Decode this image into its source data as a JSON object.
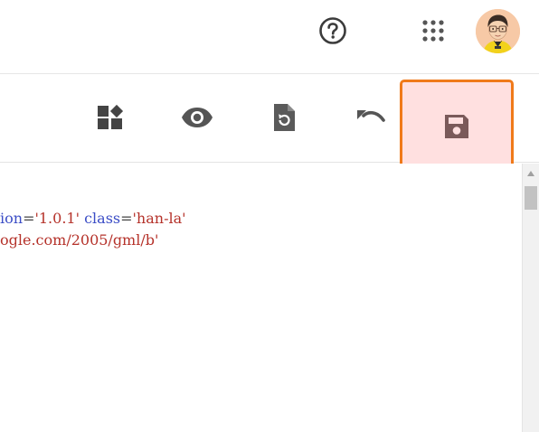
{
  "header": {
    "help_icon": "help-circle-icon",
    "apps_icon": "apps-grid-icon",
    "avatar_icon": "user-avatar"
  },
  "toolbar": {
    "widgets_icon": "widgets-icon",
    "preview_icon": "eye-icon",
    "reload_icon": "file-refresh-icon",
    "undo_icon": "undo-icon",
    "save_icon": "save-floppy-icon",
    "save_highlight_color": "#f07a1a",
    "save_bg_color": "#ffe0e0"
  },
  "editor": {
    "line1": {
      "t1": "ion",
      "t2": "=",
      "t3": "'1.0.1'",
      "t4": " ",
      "t5": "class",
      "t6": "=",
      "t7": "'han-la'"
    },
    "line2": {
      "t1": "ogle.com/2005/gml/b'"
    },
    "colors": {
      "attribute": "#3b4dc6",
      "string": "#b5322a"
    }
  }
}
